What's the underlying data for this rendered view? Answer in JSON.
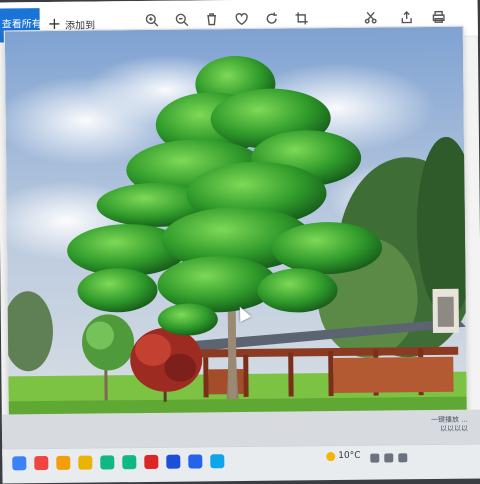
{
  "toolbar": {
    "all_photos_label": "查看所有照片",
    "add_label": "添加到",
    "buttons": [
      {
        "name": "zoom-in-button",
        "icon": "zoom-in-icon"
      },
      {
        "name": "zoom-out-button",
        "icon": "zoom-out-icon"
      },
      {
        "name": "delete-button",
        "icon": "trash-icon"
      },
      {
        "name": "favorite-button",
        "icon": "heart-icon"
      },
      {
        "name": "rotate-button",
        "icon": "rotate-icon"
      },
      {
        "name": "crop-button",
        "icon": "crop-icon"
      },
      {
        "name": "edit-button",
        "icon": "edit-icon"
      },
      {
        "name": "share-button",
        "icon": "share-icon"
      },
      {
        "name": "print-button",
        "icon": "print-icon"
      }
    ]
  },
  "notification": {
    "line1": "一键播放 ...",
    "line2": "以以以以"
  },
  "taskbar": {
    "weather": "10°C",
    "apps": [
      {
        "name": "taskbar-app-1",
        "color": "#3b82f6"
      },
      {
        "name": "taskbar-app-2",
        "color": "#ef4444"
      },
      {
        "name": "taskbar-app-3",
        "color": "#f59e0b"
      },
      {
        "name": "taskbar-app-4",
        "color": "#eab308"
      },
      {
        "name": "taskbar-app-5",
        "color": "#10b981"
      },
      {
        "name": "taskbar-app-6",
        "color": "#10b981"
      },
      {
        "name": "taskbar-app-7",
        "color": "#dc2626"
      },
      {
        "name": "taskbar-app-8",
        "color": "#1d4ed8"
      },
      {
        "name": "taskbar-app-9",
        "color": "#2563eb"
      },
      {
        "name": "taskbar-app-10",
        "color": "#0ea5e9"
      }
    ]
  },
  "colors": {
    "accent": "#1a73d6",
    "sky": "#9fb6d6",
    "grass": "#7cc243",
    "fence_wood": "#9a4a2a"
  }
}
